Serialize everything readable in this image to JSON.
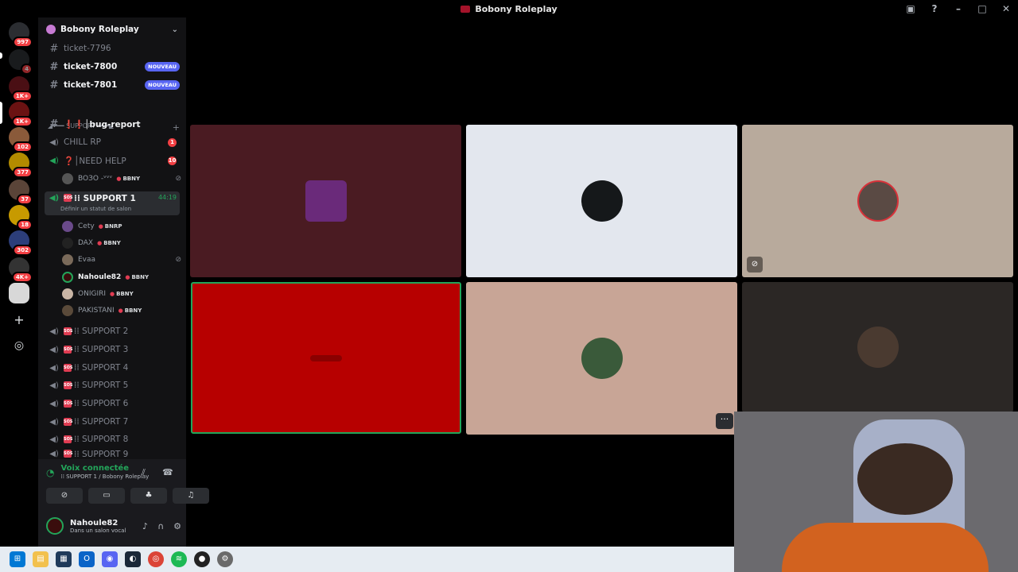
{
  "window": {
    "title": "Bobony Roleplay",
    "controls": [
      "minimize",
      "maximize",
      "close"
    ]
  },
  "guilds": {
    "badges": [
      "997",
      "4",
      "1K+",
      "1K+",
      "102",
      "377",
      "37",
      "18",
      "302",
      "4K+"
    ]
  },
  "server": {
    "name": "Bobony Roleplay"
  },
  "channels": {
    "tickets": [
      {
        "name": "ticket-7796",
        "badge": ""
      },
      {
        "name": "ticket-7800",
        "badge": "NOUVEAU"
      },
      {
        "name": "ticket-7801",
        "badge": "NOUVEAU"
      }
    ],
    "category": "◢━━━ SUPPORT ━━━◣",
    "bug_report": "❗❗│bug-report",
    "chill": {
      "name": "CHILL RP",
      "count": "1"
    },
    "needhelp": {
      "name": "❓│NEED HELP",
      "count": "10"
    },
    "needhelp_user": {
      "name": "BOЗO ‑ᵛᵛᵛ",
      "tag": "BBNY"
    },
    "support1": {
      "name": "⁞⁞ SUPPORT 1",
      "timer": "44:19",
      "status": "Définir un statut de salon"
    },
    "support1_users": [
      {
        "name": "Cety",
        "tag": "BNRP"
      },
      {
        "name": "DAX",
        "tag": "BBNY"
      },
      {
        "name": "Evaa",
        "tag": ""
      },
      {
        "name": "Nahoule82",
        "tag": "BBNY"
      },
      {
        "name": "ONIGIRI",
        "tag": "BBNY"
      },
      {
        "name": "PAKISTANI",
        "tag": "BBNY"
      }
    ],
    "supports": [
      "⁞⁞ SUPPORT 2",
      "⁞⁞ SUPPORT 3",
      "⁞⁞ SUPPORT 4",
      "⁞⁞ SUPPORT 5",
      "⁞⁞ SUPPORT 6",
      "⁞⁞ SUPPORT 7",
      "⁞⁞ SUPPORT 8",
      "⁞⁞ SUPPORT 9"
    ]
  },
  "voice": {
    "status": "Voix connectée",
    "location": "⁞⁞ SUPPORT 1 / Bobony Roleplay"
  },
  "user": {
    "name": "Nahoule82",
    "status": "Dans un salon vocal"
  },
  "colors": {
    "accent": "#5865f2",
    "online": "#23a55a",
    "alert": "#f23f43"
  }
}
